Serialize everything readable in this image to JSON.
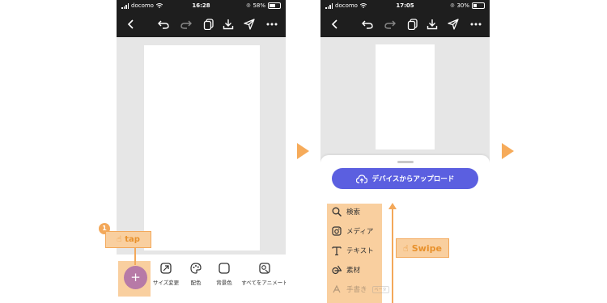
{
  "colors": {
    "accent_orange": "#f6ab5a",
    "highlight": "#f9cf9f",
    "purple": "#5b5fe0",
    "fab": "#b77aa7"
  },
  "left_phone": {
    "status": {
      "carrier": "docomo",
      "time": "16:28",
      "battery": "58%"
    },
    "bottom_items": [
      {
        "label": "サイズ変更",
        "icon": "resize-icon"
      },
      {
        "label": "配色",
        "icon": "palette-icon"
      },
      {
        "label": "背景色",
        "icon": "square-icon"
      },
      {
        "label": "すべてをアニメート",
        "icon": "animate-icon"
      }
    ],
    "fab_symbol": "+"
  },
  "right_phone": {
    "status": {
      "carrier": "docomo",
      "time": "17:05",
      "battery": "30%"
    },
    "upload_label": "デバイスからアップロード",
    "menu": [
      {
        "label": "検索",
        "icon": "search-icon"
      },
      {
        "label": "メディア",
        "icon": "media-icon"
      },
      {
        "label": "テキスト",
        "icon": "text-icon"
      },
      {
        "label": "素材",
        "icon": "shapes-icon"
      },
      {
        "label": "手書き",
        "icon": "draw-icon",
        "badge": "ベータ"
      }
    ]
  },
  "annotations": {
    "step_number": "1",
    "tap_label": "tap",
    "swipe_label": "Swipe"
  }
}
